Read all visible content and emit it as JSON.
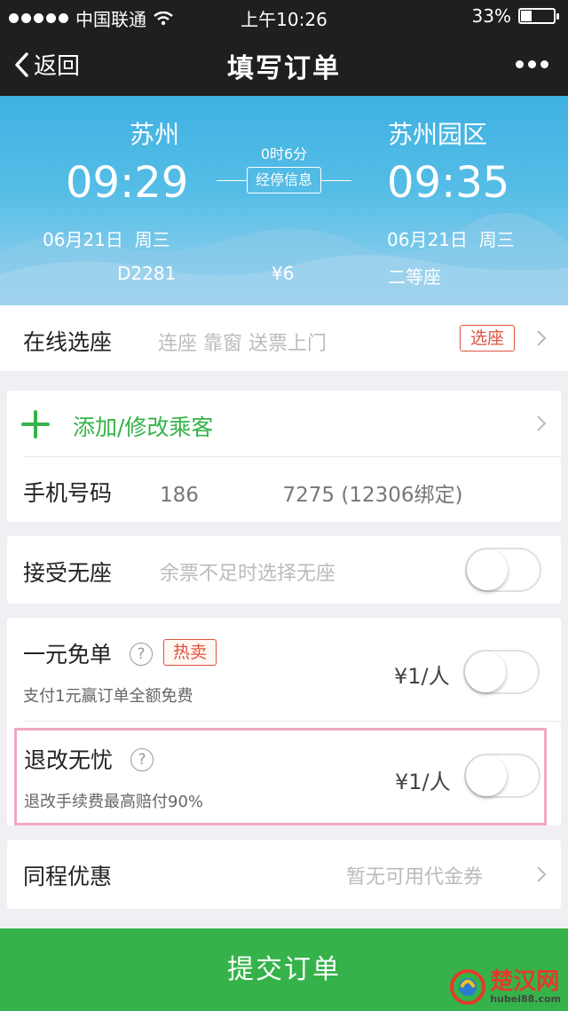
{
  "status_bar": {
    "carrier": "中国联通",
    "time": "上午10:26",
    "battery": "33%",
    "battery_level": 0.33
  },
  "nav": {
    "back_label": "返回",
    "title": "填写订单"
  },
  "trip": {
    "from_station": "苏州",
    "to_station": "苏州园区",
    "depart_time": "09:29",
    "arrive_time": "09:35",
    "duration": "0时6分",
    "stop_info": "经停信息",
    "depart_date": "06月21日",
    "depart_weekday": "周三",
    "arrive_date": "06月21日",
    "arrive_weekday": "周三",
    "train_no": "D2281",
    "price": "¥6",
    "seat_class": "二等座"
  },
  "seat_select": {
    "label": "在线选座",
    "hint": "连座 靠窗 送票上门",
    "tag": "选座"
  },
  "passenger": {
    "add_label": "添加/修改乘客",
    "phone_label": "手机号码",
    "phone_prefix": "186",
    "phone_suffix": "7275",
    "phone_note": "(12306绑定)"
  },
  "no_seat": {
    "label": "接受无座",
    "hint": "余票不足时选择无座",
    "enabled": false
  },
  "free_order": {
    "label": "一元免单",
    "tag": "热卖",
    "desc": "支付1元赢订单全额免费",
    "price": "¥1/人",
    "enabled": false
  },
  "refund": {
    "label": "退改无忧",
    "desc": "退改手续费最高赔付90%",
    "price": "¥1/人",
    "enabled": false,
    "highlight_color": "#f0a8c4"
  },
  "discount": {
    "label": "同程优惠",
    "hint": "暂无可用代金券"
  },
  "submit_label": "提交订单",
  "watermark": {
    "title": "楚汉网",
    "url": "hubei88.com"
  },
  "colors": {
    "accent_green": "#35b34a",
    "tag_red": "#e0513f",
    "hero_blue": "#4fb9e4"
  }
}
